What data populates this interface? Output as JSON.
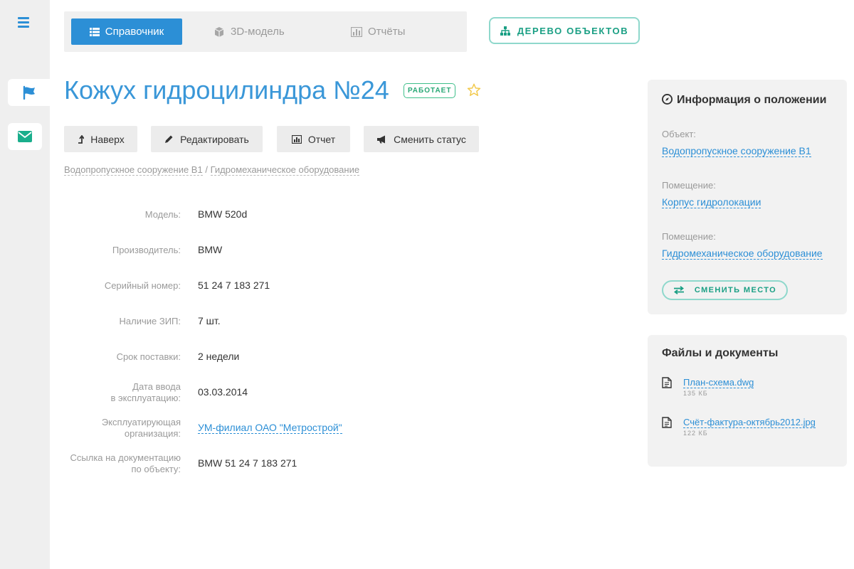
{
  "nav": {
    "reference_label": "Справочник",
    "model_label": "3D-модель",
    "reports_label": "Отчёты",
    "tree_label": "ДЕРЕВО ОБЪЕКТОВ"
  },
  "page": {
    "title": "Кожух гидроцилиндра №24",
    "status_badge": "РАБОТАЕТ"
  },
  "actions": {
    "up_label": "Наверх",
    "edit_label": "Редактировать",
    "report_label": "Отчет",
    "status_label": "Сменить статус"
  },
  "breadcrumb": {
    "items": [
      "Водопропускное сооружение В1",
      "Гидромеханическое оборудование"
    ],
    "separator": "/"
  },
  "details": [
    {
      "label": "Модель:",
      "value": "BMW 520d"
    },
    {
      "label": "Производитель:",
      "value": "BMW"
    },
    {
      "label": "Серийный номер:",
      "value": "51 24 7 183 271"
    },
    {
      "label": "Наличие ЗИП:",
      "value": "7 шт."
    },
    {
      "label": "Срок поставки:",
      "value": "2 недели"
    },
    {
      "label_line1": "Дата ввода",
      "label_line2": "в эксплуатацию:",
      "value": "03.03.2014"
    },
    {
      "label_line1": "Эксплуатирующая",
      "label_line2": "организация:",
      "value": "УМ-филиал ОАО \"Метрострой\""
    },
    {
      "label_line1": "Ссылка на документацию",
      "label_line2": "по объекту:",
      "value": "BMW 51 24 7 183 271"
    }
  ],
  "location": {
    "title": "Информация о положении",
    "items": [
      {
        "label": "Объект:",
        "value": "Водопропускное сооружение В1"
      },
      {
        "label": "Помещение:",
        "value": "Корпус гидролокации"
      },
      {
        "label": "Помещение:",
        "value": "Гидромеханическое оборудование"
      }
    ],
    "move_label": "СМЕНИТЬ МЕСТО"
  },
  "files": {
    "title": "Файлы и документы",
    "items": [
      {
        "name": "План-схема.dwg",
        "size": "135 КБ"
      },
      {
        "name": "Счёт-фактура-октябрь2012.jpg",
        "size": "122 КБ"
      }
    ]
  },
  "colors": {
    "accent": "#2c8fd6",
    "teal": "#1a9f84",
    "status": "#2aa876",
    "star": "#f2c94c"
  },
  "icons": {
    "menu": "menu-icon",
    "flag": "flag-icon",
    "mail": "mail-icon",
    "star": "star-icon"
  }
}
